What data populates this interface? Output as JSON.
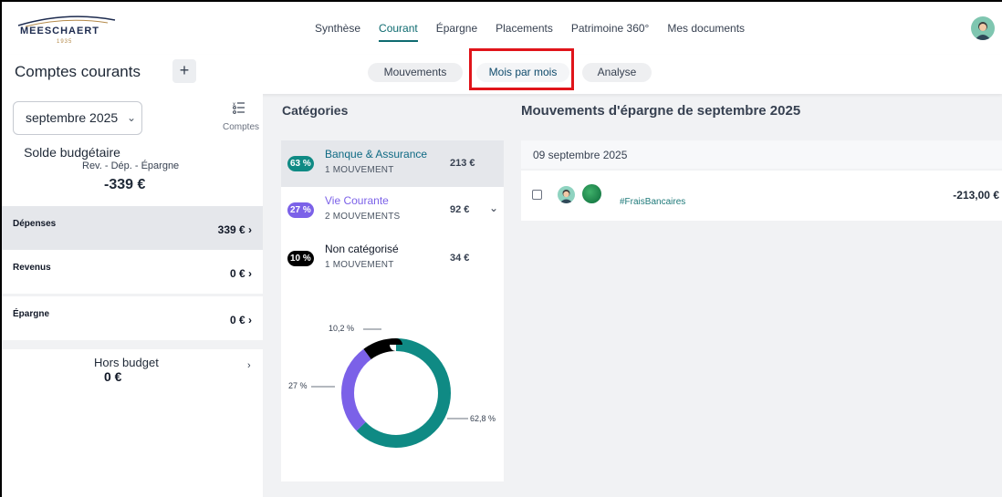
{
  "logo": {
    "name": "MEESCHAERT",
    "year": "1935"
  },
  "nav": {
    "items": [
      "Synthèse",
      "Courant",
      "Épargne",
      "Placements",
      "Patrimoine 360°",
      "Mes documents"
    ],
    "active": "Courant"
  },
  "header": {
    "title": "Comptes courants",
    "add_label": "+",
    "subtabs": [
      "Mouvements",
      "Mois par mois",
      "Analyse"
    ],
    "active_subtab": "Mois par mois"
  },
  "left": {
    "month": "septembre 2025",
    "comptes_label": "Comptes",
    "solde_title": "Solde budgétaire",
    "solde_sub": "Rev. - Dép. - Épargne",
    "solde_value": "-339 €",
    "rows": [
      {
        "label": "Dépenses",
        "value": "339 € ›"
      },
      {
        "label": "Revenus",
        "value": "0 € ›"
      },
      {
        "label": "Épargne",
        "value": "0 € ›"
      }
    ],
    "hors_budget": {
      "title": "Hors budget",
      "value": "0 €",
      "chevron": "›"
    }
  },
  "categories": {
    "title": "Catégories",
    "items": [
      {
        "pct": "63 %",
        "name": "Banque & Assurance",
        "count": "1 MOUVEMENT",
        "value": "213 €",
        "color": "#0f8a84"
      },
      {
        "pct": "27 %",
        "name": "Vie Courante",
        "count": "2 MOUVEMENTS",
        "value": "92 €",
        "color": "#7b61e8"
      },
      {
        "pct": "10 %",
        "name": "Non catégorisé",
        "count": "1 MOUVEMENT",
        "value": "34 €",
        "color": "#000000"
      }
    ],
    "donut": {
      "labels": [
        "10,2 %",
        "27 %",
        "62,8 %"
      ],
      "values": [
        62.8,
        27,
        10.2
      ],
      "colors": [
        "#0f8a84",
        "#7b61e8",
        "#000000"
      ]
    }
  },
  "mouvements": {
    "title": "Mouvements d'épargne de septembre 2025",
    "date": "09 septembre 2025",
    "items": [
      {
        "tag": "#FraisBancaires",
        "amount": "-213,00 €"
      }
    ]
  }
}
